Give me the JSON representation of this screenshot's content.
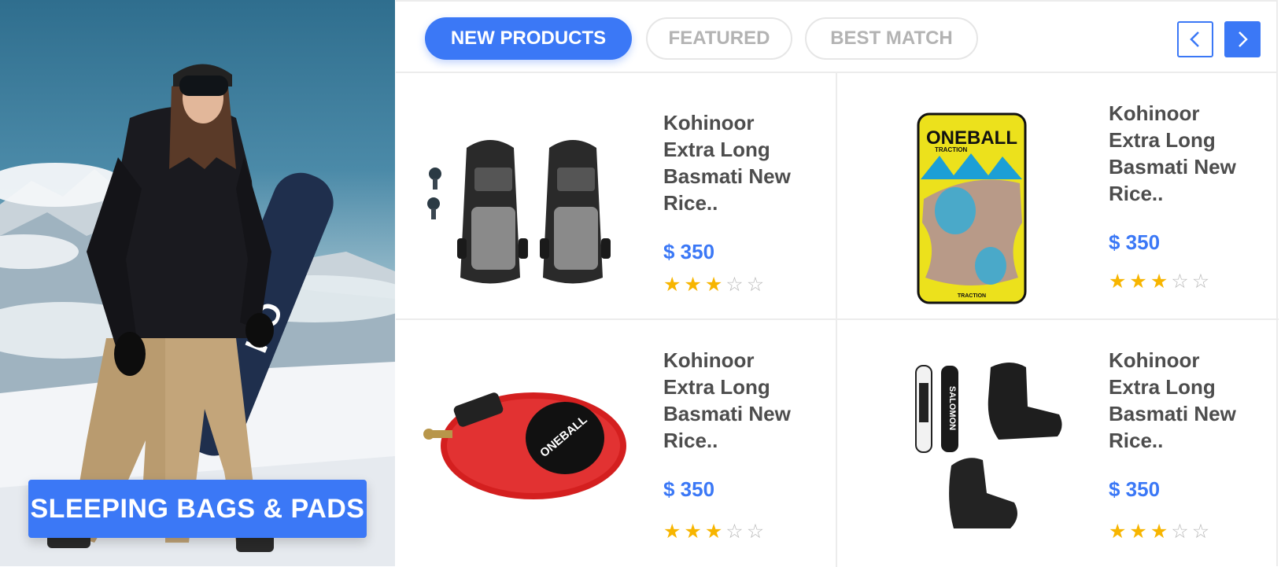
{
  "hero": {
    "cta_label": "SLEEPING BAGS & PADS"
  },
  "tabs": [
    {
      "label": "NEW PRODUCTS",
      "active": true
    },
    {
      "label": "FEATURED",
      "active": false
    },
    {
      "label": "BEST MATCH",
      "active": false
    }
  ],
  "nav": {
    "prev_icon": "chevron-left-icon",
    "next_icon": "chevron-right-icon"
  },
  "colors": {
    "accent": "#3b78f6",
    "star": "#f7b500",
    "text": "#4d4d4d"
  },
  "products": [
    {
      "name": "Kohinoor Extra Long Basmati New Rice..",
      "price": "$ 350",
      "rating": 3,
      "rating_max": 5,
      "image": "snowboard-bindings-product"
    },
    {
      "name": "Kohinoor Extra Long Basmati New Rice..",
      "price": "$ 350",
      "rating": 3,
      "rating_max": 5,
      "image": "traction-pad-product",
      "brand_text": "ONEBALL",
      "brand_subtext": "TRACTION"
    },
    {
      "name": "Kohinoor Extra Long Basmati New Rice..",
      "price": "$ 350",
      "rating": 3,
      "rating_max": 5,
      "image": "cable-lock-product",
      "brand_text": "ONEBALL"
    },
    {
      "name": "Kohinoor Extra Long Basmati New Rice..",
      "price": "$ 350",
      "rating": 3,
      "rating_max": 5,
      "image": "snowboard-package-product",
      "brand_text": "SALOMON"
    }
  ]
}
